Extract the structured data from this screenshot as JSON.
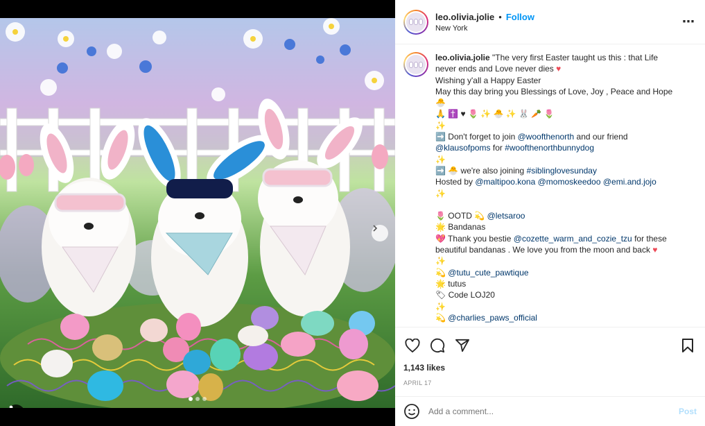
{
  "post": {
    "username": "leo.olivia.jolie",
    "separator": "•",
    "follow_label": "Follow",
    "location": "New York",
    "more_icon": "⋯",
    "carousel": {
      "active_index": 0,
      "count": 3
    },
    "caption_lines": [
      [
        "\"The very first Easter taught us this : that Life"
      ],
      [
        "never ends and Love never dies ",
        "♥"
      ],
      [
        "Wishing y'all a Happy Easter"
      ],
      [
        "May this day bring you Blessings of Love, Joy , Peace and Hope"
      ],
      [
        "🐣"
      ],
      [
        "🙏 ✝️ ♥ 🌷 ✨ 🐣 ✨ 🐰 🥕 🌷"
      ],
      [
        "✨"
      ],
      [
        "➡️ Don't forget to join ",
        "@woofthenorth",
        " and our friend"
      ],
      [
        "@klausofpoms",
        " for ",
        "#woofthenorthbunnydog"
      ],
      [
        "✨"
      ],
      [
        "➡️ 🐣 we're also joining ",
        "#siblinglovesunday"
      ],
      [
        "Hosted by ",
        "@maltipoo.kona",
        " ",
        "@momoskeedoo",
        " ",
        "@emi.and.jojo"
      ],
      [
        "✨"
      ],
      [
        ""
      ],
      [
        "🌷 OOTD  💫  ",
        "@letsaroo"
      ],
      [
        "🌟  Bandanas"
      ],
      [
        "💖 Thank you bestie ",
        "@cozette_warm_and_cozie_tzu",
        " for these"
      ],
      [
        "beautiful bandanas . We love you from the moon and back ",
        "♥"
      ],
      [
        "✨"
      ],
      [
        "💫  ",
        "@tutu_cute_pawtique"
      ],
      [
        "🌟  tutus"
      ],
      [
        "🏷 Code LOJ20"
      ],
      [
        "✨"
      ],
      [
        "💫  ",
        "@charlies_paws_official"
      ]
    ],
    "likes": "1,143 likes",
    "date": "APRIL 17",
    "comment_placeholder": "Add a comment...",
    "post_label": "Post",
    "accent_color": "#0095f6",
    "heart_color": "#ed4956"
  }
}
